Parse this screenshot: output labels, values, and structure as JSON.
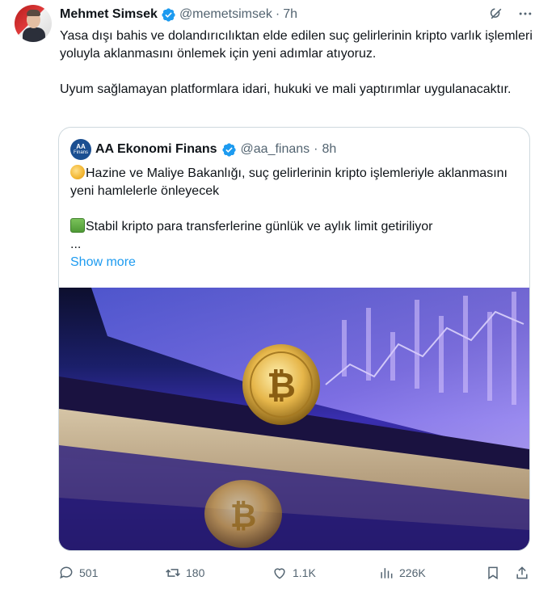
{
  "tweet": {
    "author_name": "Mehmet Simsek",
    "author_handle": "@memetsimsek",
    "separator": "·",
    "time": "7h",
    "text_paragraphs": [
      "Yasa dışı bahis ve dolandırıcılıktan elde edilen suç gelirlerinin kripto varlık işlemleri yoluyla aklanmasını önlemek için yeni adımlar atıyoruz.",
      "Uyum sağlamayan platformlara idari, hukuki ve mali yaptırımlar uygulanacaktır."
    ]
  },
  "quote": {
    "author_name": "AA Ekonomi Finans",
    "author_handle": "@aa_finans",
    "separator": "·",
    "time": "8h",
    "avatar_text_top": "AA",
    "avatar_text_bottom": "Finans",
    "line1": "Hazine ve Maliye Bakanlığı, suç gelirlerinin kripto işlemleriyle aklanmasını yeni hamlelerle önleyecek",
    "line2": "Stabil kripto para transferlerine günlük ve aylık limit getiriliyor",
    "ellipsis": "...",
    "show_more": "Show more",
    "image_alt": "bitcoin coin on laptop keyboard with chart"
  },
  "actions": {
    "replies": "501",
    "reposts": "180",
    "likes": "1.1K",
    "views": "226K"
  },
  "icons": {
    "verified": "verified-badge-icon",
    "grok": "grok-icon",
    "more": "more-icon",
    "reply": "reply-icon",
    "repost": "repost-icon",
    "like": "like-icon",
    "views": "views-icon",
    "bookmark": "bookmark-icon",
    "share": "share-icon"
  },
  "colors": {
    "link": "#1d9bf0",
    "verified": "#1d9bf0",
    "secondary_text": "#536471",
    "border": "#cfd9de"
  }
}
